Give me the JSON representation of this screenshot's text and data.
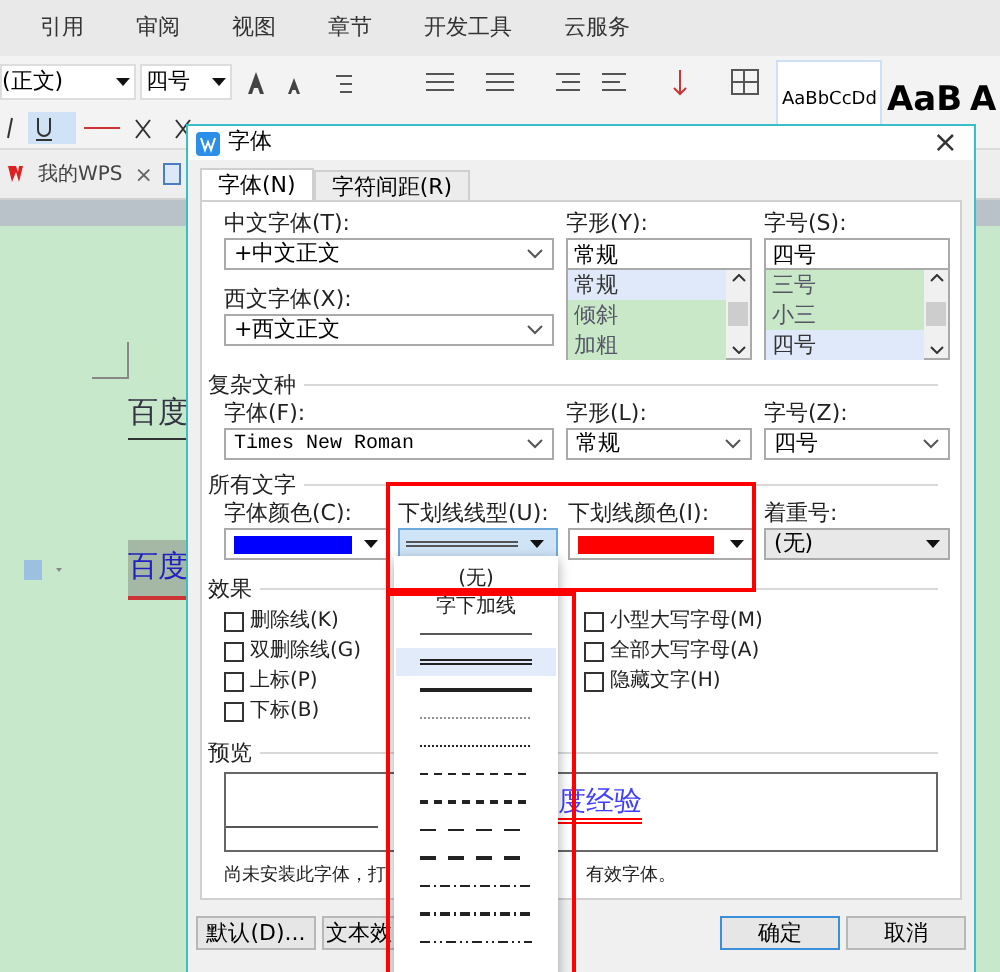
{
  "ribbon_tabs": [
    "引用",
    "审阅",
    "视图",
    "章节",
    "开发工具",
    "云服务"
  ],
  "toolbar": {
    "font_name": "(正文)",
    "font_size": "四号",
    "styles": [
      {
        "sample": "AaBbCcDd",
        "kind": "small"
      },
      {
        "sample": "AaB",
        "kind": "big"
      },
      {
        "sample": "A",
        "kind": "big"
      }
    ]
  },
  "tab_bar": {
    "tabs": [
      {
        "label": "我的WPS",
        "close": "×"
      }
    ]
  },
  "document": {
    "lines": [
      {
        "text": "百度",
        "highlighted": false
      },
      {
        "text": "百度",
        "highlighted": true
      }
    ]
  },
  "dialog": {
    "title": "字体",
    "close": "×",
    "tabs": [
      {
        "label": "字体(N)",
        "selected": true
      },
      {
        "label": "字符间距(R)",
        "selected": false
      }
    ],
    "chinese_font": {
      "label": "中文字体(T):",
      "value": "+中文正文"
    },
    "style": {
      "label": "字形(Y):",
      "value": "常规",
      "options": [
        {
          "label": "常规",
          "selected": true
        },
        {
          "label": "倾斜",
          "selected": false
        },
        {
          "label": "加粗",
          "selected": false
        }
      ]
    },
    "size": {
      "label": "字号(S):",
      "value": "四号",
      "options": [
        {
          "label": "三号",
          "selected": false
        },
        {
          "label": "小三",
          "selected": false
        },
        {
          "label": "四号",
          "selected": true
        }
      ]
    },
    "western_font": {
      "label": "西文字体(X):",
      "value": "+西文正文"
    },
    "complex_section": "复杂文种",
    "complex_font": {
      "label": "字体(F):",
      "value": "Times New Roman"
    },
    "complex_style": {
      "label": "字形(L):",
      "value": "常规"
    },
    "complex_size": {
      "label": "字号(Z):",
      "value": "四号"
    },
    "all_text_section": "所有文字",
    "font_color": {
      "label": "字体颜色(C):",
      "color": "#0000ff"
    },
    "underline_style": {
      "label": "下划线线型(U):"
    },
    "underline_color": {
      "label": "下划线颜色(I):",
      "color": "#ff0000"
    },
    "emphasis": {
      "label": "着重号:",
      "value": "(无)"
    },
    "effects_section": "效果",
    "effects": [
      {
        "label": "删除线(K)",
        "checked": false
      },
      {
        "label": "双删除线(G)",
        "checked": false
      },
      {
        "label": "上标(P)",
        "checked": false
      },
      {
        "label": "下标(B)",
        "checked": false
      },
      {
        "label": "小型大写字母(M)",
        "checked": false
      },
      {
        "label": "全部大写字母(A)",
        "checked": false
      },
      {
        "label": "隐藏文字(H)",
        "checked": false
      }
    ],
    "preview_section": "预览",
    "preview_text": "度经验",
    "note": [
      "尚未安装此字体，打",
      "有效字体。"
    ],
    "buttons": [
      {
        "label": "默认(D)...",
        "kind": "plain"
      },
      {
        "label": "文本效",
        "kind": "plain"
      },
      {
        "label": "确定",
        "kind": "primary"
      },
      {
        "label": "取消",
        "kind": "plain"
      }
    ]
  },
  "underline_menu": {
    "items": [
      {
        "kind": "text",
        "label": "(无)",
        "selected": false
      },
      {
        "kind": "text",
        "label": "字下加线",
        "selected": false
      },
      {
        "kind": "line",
        "selected": false
      },
      {
        "kind": "line",
        "selected": true
      },
      {
        "kind": "line",
        "selected": false
      },
      {
        "kind": "line",
        "selected": false
      },
      {
        "kind": "line",
        "selected": false
      },
      {
        "kind": "line",
        "selected": false
      },
      {
        "kind": "line",
        "selected": false
      },
      {
        "kind": "line",
        "selected": false
      },
      {
        "kind": "line",
        "selected": false
      },
      {
        "kind": "line",
        "selected": false
      },
      {
        "kind": "line",
        "selected": false
      },
      {
        "kind": "line",
        "selected": false
      }
    ]
  }
}
